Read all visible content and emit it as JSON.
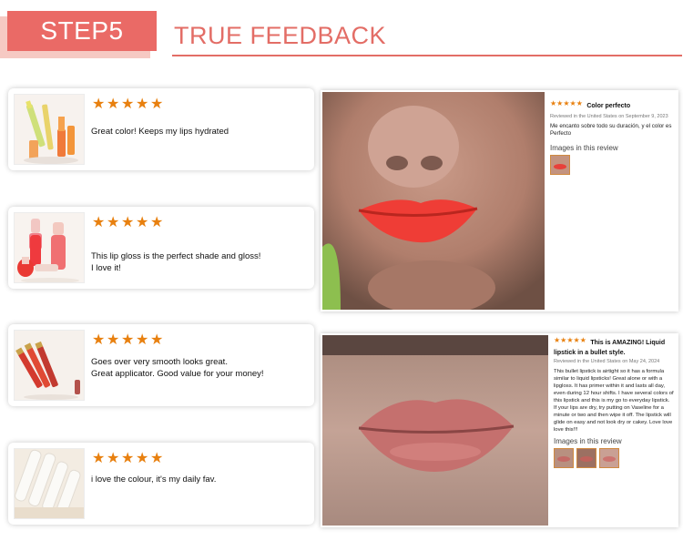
{
  "header": {
    "step_label": "STEP5",
    "title": "TRUE FEEDBACK"
  },
  "colors": {
    "accent": "#e36d66",
    "badge": "#ea6a66",
    "star": "#e8800f"
  },
  "reviews": [
    {
      "rating": 5,
      "text": "Great color! Keeps my lips hydrated",
      "image": "lip-oil-product-photo"
    },
    {
      "rating": 5,
      "text": "This lip gloss is the perfect shade and gloss!\nI love it!",
      "image": "lip-gloss-product-photo"
    },
    {
      "rating": 5,
      "text": "Goes over very smooth looks great.\nGreat applicator. Good value for your money!",
      "image": "liquid-lipstick-product-photo"
    },
    {
      "rating": 5,
      "text": "i love the colour, it's my daily fav.",
      "image": "white-tubes-product-photo"
    }
  ],
  "panels": [
    {
      "rating": 5,
      "title": "Color perfecto",
      "meta": "Reviewed in the United States on September 9, 2023",
      "body": "Me encanto sobre todo su duración, y el color es Perfecto",
      "images_label": "Images in this review",
      "photo": "red-lips-customer-photo"
    },
    {
      "rating": 5,
      "title": "This is AMAZING! Liquid lipstick in a bullet style.",
      "meta": "Reviewed in the United States on May 24, 2024",
      "body": "This bullet lipstick is airtight so it has a formula similar to liquid lipsticks! Great alone or with a lipgloss. It has primer within it and lasts all day, even during 12 hour shifts. I have several colors of this lipstick and this is my go to everyday lipstick. If your lips are dry, try putting on Vaseline for a minute or two and then wipe it off. The lipstick will glide on easy and not look dry or cakey. Love love love this!!!",
      "images_label": "Images in this review",
      "photo": "nude-lips-customer-photo"
    }
  ]
}
